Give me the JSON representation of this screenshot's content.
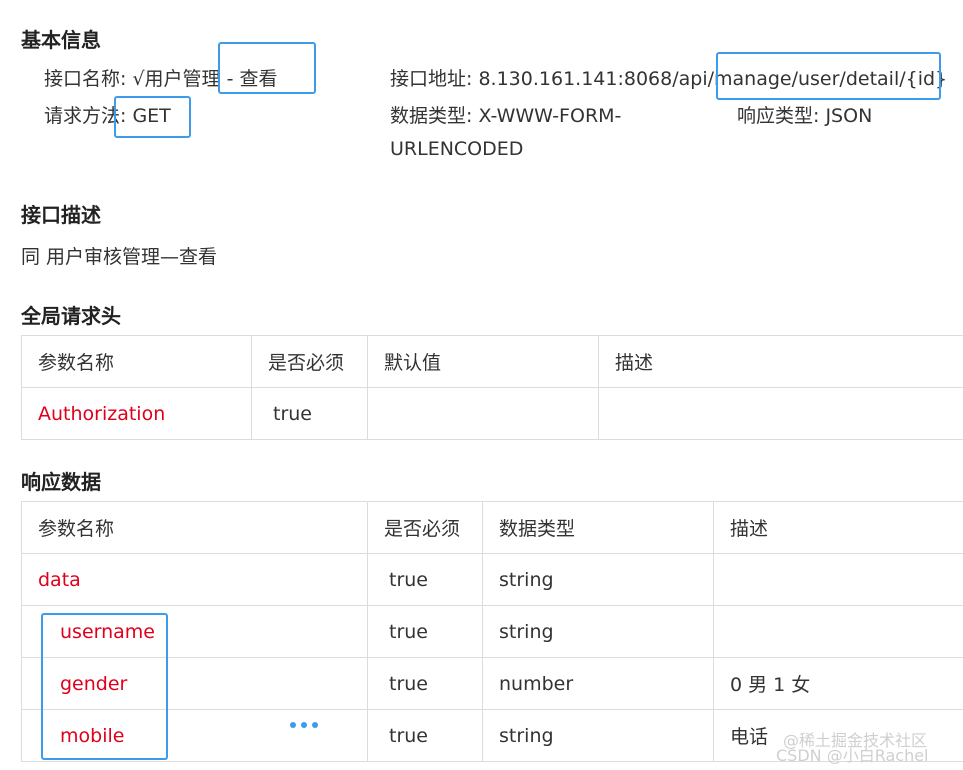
{
  "basic": {
    "title": "基本信息",
    "name_label": "接口名称: ",
    "name_value": "√用户管理 - 查看",
    "url_label": "接口地址: ",
    "url_value": "8.130.161.141:8068/api/manage/user/detail/{id}",
    "method_label": "请求方法: ",
    "method_value": "GET",
    "datatype_label": "数据类型: ",
    "datatype_value1": "X-WWW-FORM-",
    "datatype_value2": "URLENCODED",
    "resp_label": "响应类型: ",
    "resp_value": "JSON"
  },
  "desc": {
    "title": "接口描述",
    "text": "同 用户审核管理—查看"
  },
  "headers": {
    "title": "全局请求头",
    "columns": [
      "参数名称",
      "是否必须",
      "默认值",
      "描述"
    ],
    "rows": [
      {
        "name": "Authorization",
        "required": "true",
        "default": "",
        "desc": ""
      }
    ]
  },
  "response": {
    "title": "响应数据",
    "columns": [
      "参数名称",
      "是否必须",
      "数据类型",
      "描述"
    ],
    "rows": [
      {
        "name": "data",
        "required": "true",
        "type": "string",
        "desc": ""
      },
      {
        "name": "username",
        "required": "true",
        "type": "string",
        "desc": ""
      },
      {
        "name": "gender",
        "required": "true",
        "type": "number",
        "desc": "0 男 1 女"
      },
      {
        "name": "mobile",
        "required": "true",
        "type": "string",
        "desc": "电话"
      }
    ]
  },
  "watermark": {
    "line1": "@稀土掘金技术社区",
    "line2": "CSDN @小白Rachel"
  },
  "colors": {
    "param_name": "#e0001b",
    "highlight": "#3d9be9"
  }
}
